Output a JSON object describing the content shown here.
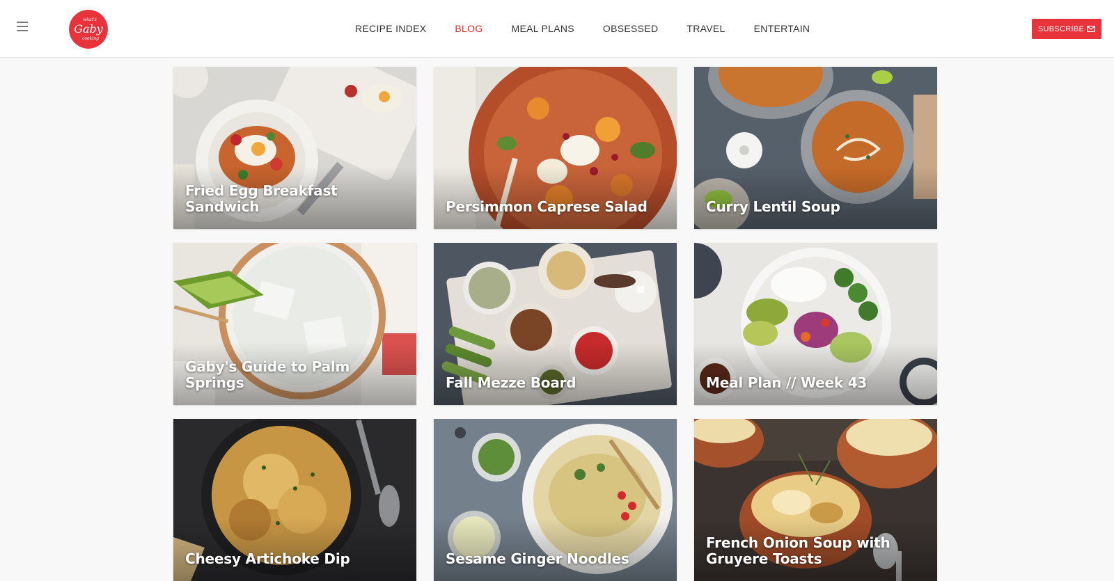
{
  "header": {
    "logo_text": {
      "top": "what's",
      "main": "Gaby",
      "bottom": "cooking"
    },
    "nav": [
      {
        "label": "RECIPE INDEX",
        "active": false
      },
      {
        "label": "BLOG",
        "active": true
      },
      {
        "label": "MEAL PLANS",
        "active": false
      },
      {
        "label": "OBSESSED",
        "active": false
      },
      {
        "label": "TRAVEL",
        "active": false
      },
      {
        "label": "ENTERTAIN",
        "active": false
      }
    ],
    "subscribe_label": "SUBSCRIBE",
    "subscribe_icon": "envelope-icon"
  },
  "colors": {
    "accent": "#e52b2b",
    "subscribe_bg": "#e8333a",
    "page_bg": "#f8f8f8"
  },
  "posts": [
    {
      "title": "Fried Egg Breakfast Sandwich"
    },
    {
      "title": "Persimmon Caprese Salad"
    },
    {
      "title": "Curry Lentil Soup"
    },
    {
      "title": "Gaby's Guide to Palm Springs"
    },
    {
      "title": "Fall Mezze Board"
    },
    {
      "title": "Meal Plan // Week 43"
    },
    {
      "title": "Cheesy Artichoke Dip"
    },
    {
      "title": "Sesame Ginger Noodles"
    },
    {
      "title": "French Onion Soup with Gruyere Toasts"
    }
  ]
}
